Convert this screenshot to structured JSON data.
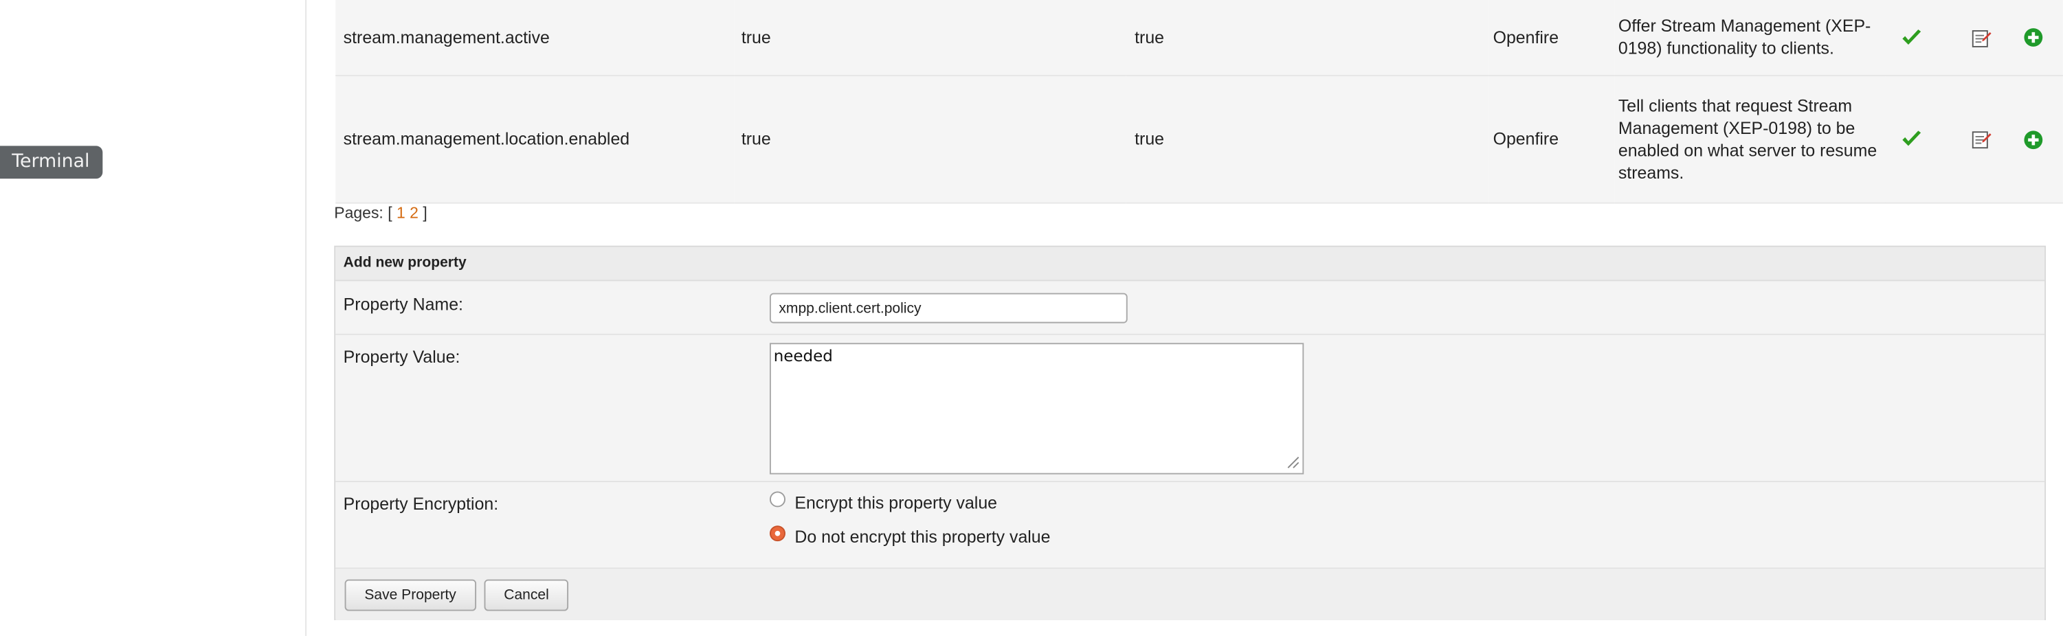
{
  "overlay": {
    "terminal_label": "Terminal"
  },
  "properties": [
    {
      "name": "stream.management.active",
      "value": "true",
      "default": "true",
      "source": "Openfire",
      "description": "Offer Stream Management (XEP-0198) functionality to clients."
    },
    {
      "name": "stream.management.location.enabled",
      "value": "true",
      "default": "true",
      "source": "Openfire",
      "description": "Tell clients that request Stream Management (XEP-0198) to be enabled on what server to resume streams."
    }
  ],
  "icons": {
    "status": "checkmark-icon",
    "edit": "edit-icon",
    "add": "add-icon"
  },
  "colors": {
    "accent_orange": "#d46a10",
    "check_green": "#2e9e1f",
    "add_green": "#1f9a2a",
    "radio_selected": "#e9683b"
  },
  "pagination": {
    "prefix": "Pages: [",
    "pages": [
      "1",
      "2"
    ],
    "suffix": "]"
  },
  "form": {
    "title": "Add new property",
    "name_label": "Property Name:",
    "name_value": "xmpp.client.cert.policy",
    "value_label": "Property Value:",
    "value_text": "needed",
    "encryption_label": "Property Encryption:",
    "encrypt_option": "Encrypt this property value",
    "no_encrypt_option": "Do not encrypt this property value",
    "selected_encryption": "Do not encrypt this property value",
    "save_label": "Save Property",
    "cancel_label": "Cancel"
  }
}
